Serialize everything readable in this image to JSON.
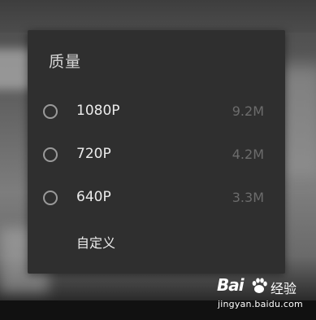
{
  "dialog": {
    "title": "质量",
    "options": [
      {
        "label": "1080P",
        "size": "9.2M"
      },
      {
        "label": "720P",
        "size": "4.2M"
      },
      {
        "label": "640P",
        "size": "3.3M"
      }
    ],
    "custom_label": "自定义"
  },
  "watermark": {
    "brand_left": "Bai",
    "brand_right": "经验",
    "url": "jingyan.baidu.com"
  },
  "colors": {
    "dialog_bg": "#2f2f2f",
    "title_text": "#d6d6d6",
    "option_text": "#ececec",
    "size_text": "#6c6c6c",
    "radio_border": "#9a9a9a"
  }
}
